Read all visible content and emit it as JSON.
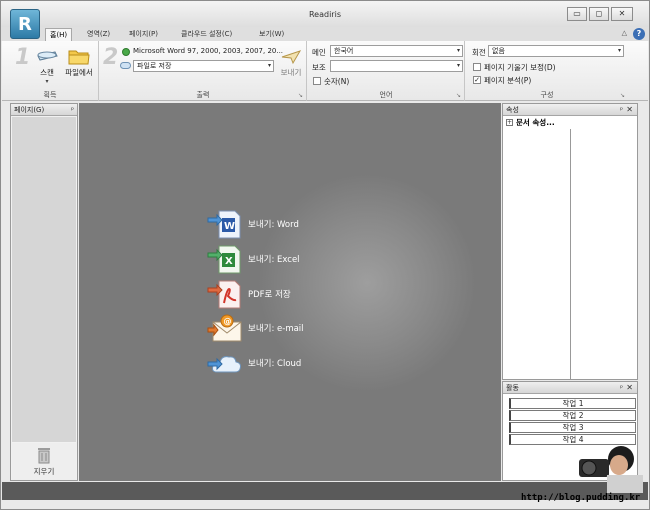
{
  "window": {
    "title": "Readiris",
    "controls": {
      "minimize": "▭",
      "maximize": "◻",
      "close": "✕"
    }
  },
  "tabs": [
    {
      "label": "홈(H)",
      "active": true
    },
    {
      "label": "영역(Z)",
      "active": false
    },
    {
      "label": "페이지(P)",
      "active": false
    },
    {
      "label": "클라우드 설정(C)",
      "active": false
    },
    {
      "label": "보기(W)",
      "active": false
    }
  ],
  "help": "?",
  "ribbon": {
    "acquire": {
      "step": "1",
      "scan_label": "스캔",
      "fromfile_label": "파일에서",
      "group_label": "획득"
    },
    "output": {
      "step": "2",
      "format_value": "Microsoft Word 97, 2000, 2003, 2007, 20...",
      "target_value": "파일로 저장",
      "send_label": "보내기",
      "group_label": "출력"
    },
    "language": {
      "main_label": "메인",
      "main_value": "한국어",
      "sub_label": "보조",
      "sub_value": "",
      "numbers_label": "숫자(N)",
      "numbers_checked": false,
      "group_label": "언어"
    },
    "config": {
      "rotate_label": "회전",
      "rotate_value": "없음",
      "deskew_label": "페이지 기울기 보정(D)",
      "deskew_checked": false,
      "analyze_label": "페이지 분석(P)",
      "analyze_checked": true,
      "group_label": "구성"
    }
  },
  "left_pane": {
    "title": "페이지(G)",
    "pin": "ᵖ",
    "clear_label": "지우기"
  },
  "main_actions": [
    {
      "label": "보내기: Word",
      "icon": "word-doc-icon"
    },
    {
      "label": "보내기: Excel",
      "icon": "excel-doc-icon"
    },
    {
      "label": "PDF로 저장",
      "icon": "pdf-doc-icon"
    },
    {
      "label": "보내기: e-mail",
      "icon": "email-envelope-icon"
    },
    {
      "label": "보내기: Cloud",
      "icon": "cloud-icon"
    }
  ],
  "properties_pane": {
    "title": "속성",
    "row_label": "문서 속성..."
  },
  "activity_pane": {
    "title": "활동",
    "jobs": [
      "작업 1",
      "작업 2",
      "작업 3",
      "작업 4"
    ]
  },
  "watermark": "http://blog.pudding.kr",
  "colors": {
    "accent": "#2d7aa6",
    "workspace": "#7a7a7a"
  }
}
